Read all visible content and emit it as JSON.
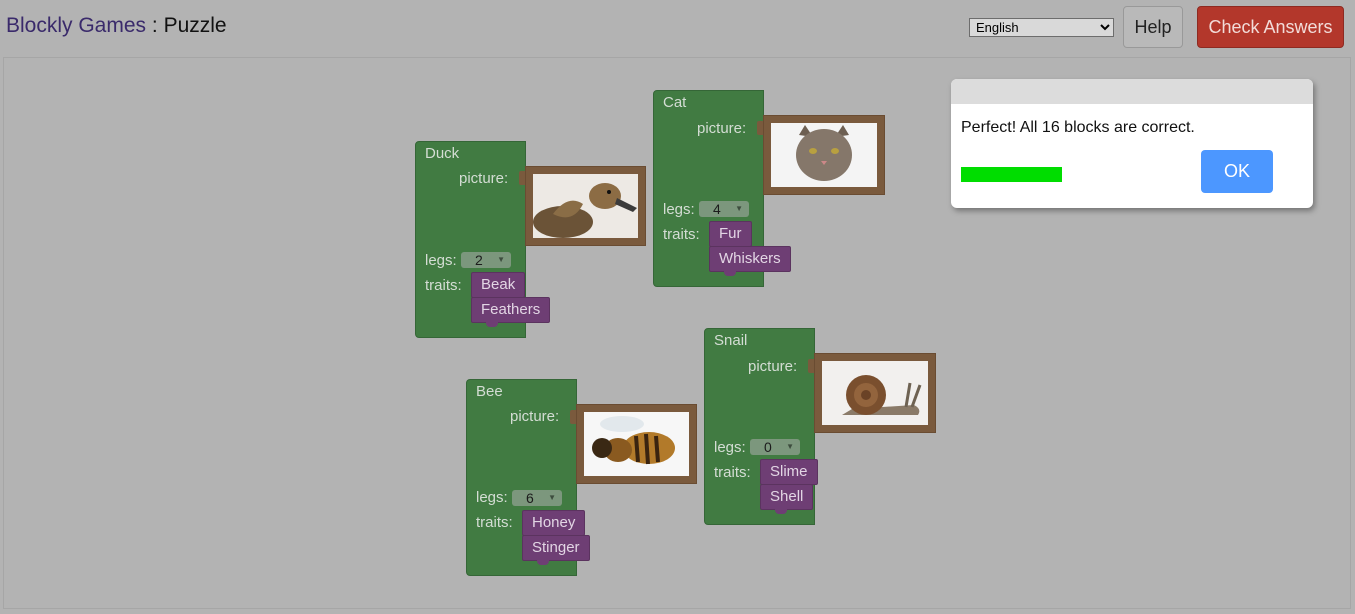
{
  "header": {
    "brand": "Blockly Games",
    "separator": " : ",
    "page_title": "Puzzle",
    "language": "English",
    "help_label": "Help",
    "check_label": "Check Answers"
  },
  "labels": {
    "picture": "picture:",
    "legs": "legs:",
    "traits": "traits:"
  },
  "blocks": [
    {
      "name": "Duck",
      "legs": "2",
      "traits": [
        "Beak",
        "Feathers"
      ],
      "picture_icon": "duck-picture"
    },
    {
      "name": "Cat",
      "legs": "4",
      "traits": [
        "Fur",
        "Whiskers"
      ],
      "picture_icon": "cat-picture"
    },
    {
      "name": "Bee",
      "legs": "6",
      "traits": [
        "Honey",
        "Stinger"
      ],
      "picture_icon": "bee-picture"
    },
    {
      "name": "Snail",
      "legs": "0",
      "traits": [
        "Slime",
        "Shell"
      ],
      "picture_icon": "snail-picture"
    }
  ],
  "dialog": {
    "message": "Perfect! All 16 blocks are correct.",
    "ok_label": "OK",
    "progress_percent": 100
  },
  "colors": {
    "block_green": "#417b42",
    "trait_purple": "#6e3e74",
    "picture_frame": "#7a5a3d",
    "check_button": "#b3372b",
    "ok_button": "#4c97ff",
    "progress": "#00dd00"
  }
}
